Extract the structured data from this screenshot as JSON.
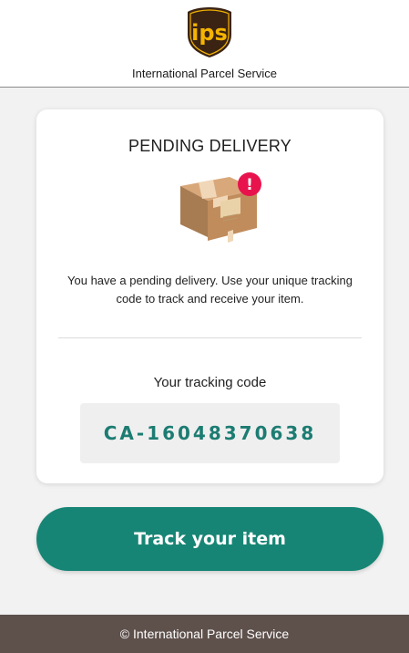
{
  "header": {
    "logo_text": "ips",
    "brand_name": "International Parcel Service"
  },
  "card": {
    "title": "PENDING DELIVERY",
    "description": "You have a pending delivery. Use your unique tracking code to track and receive your item.",
    "alert_glyph": "!",
    "tracking_label": "Your tracking code",
    "tracking_code": "CA-16048370638"
  },
  "actions": {
    "track_label": "Track your item"
  },
  "footer": {
    "text": "© International Parcel Service"
  },
  "colors": {
    "accent": "#178575",
    "code_text": "#1c7c72",
    "alert": "#e8134d",
    "footer_bg": "#5e514c",
    "logo_bg": "#3b2314",
    "logo_gold": "#f4b400"
  },
  "icons": {
    "logo": "ips-shield-logo",
    "package": "package-box-icon",
    "alert": "alert-exclamation-icon"
  }
}
